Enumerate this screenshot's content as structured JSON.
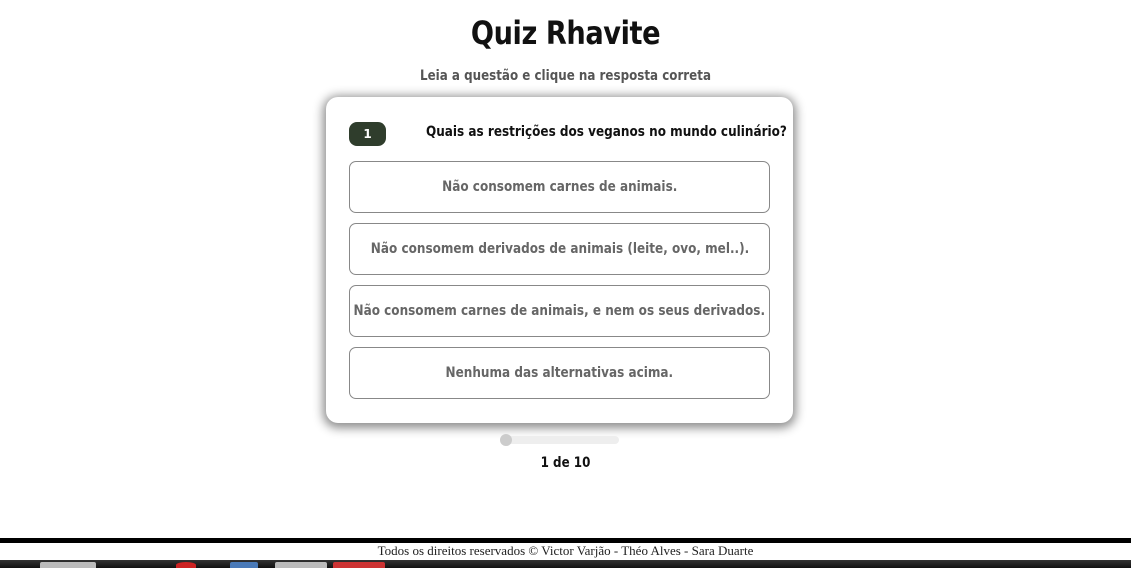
{
  "header": {
    "title": "Quiz Rhavite",
    "subtitle": "Leia a questão e clique na resposta correta"
  },
  "question": {
    "number": "1",
    "text": "Quais as restrições dos veganos no mundo culinário?",
    "options": [
      "Não consomem carnes de animais.",
      "Não consomem derivados de animais (leite, ovo, mel..).",
      "Não consomem carnes de animais, e nem os seus derivados.",
      "Nenhuma das alternativas acima."
    ]
  },
  "progress": {
    "value": 0,
    "label": "1 de 10"
  },
  "footer": {
    "text": "Todos os direitos reservados © Victor Varjão - Théo Alves - Sara Duarte"
  },
  "colors": {
    "badge": "#2f3d2c",
    "option_text": "#666666"
  }
}
